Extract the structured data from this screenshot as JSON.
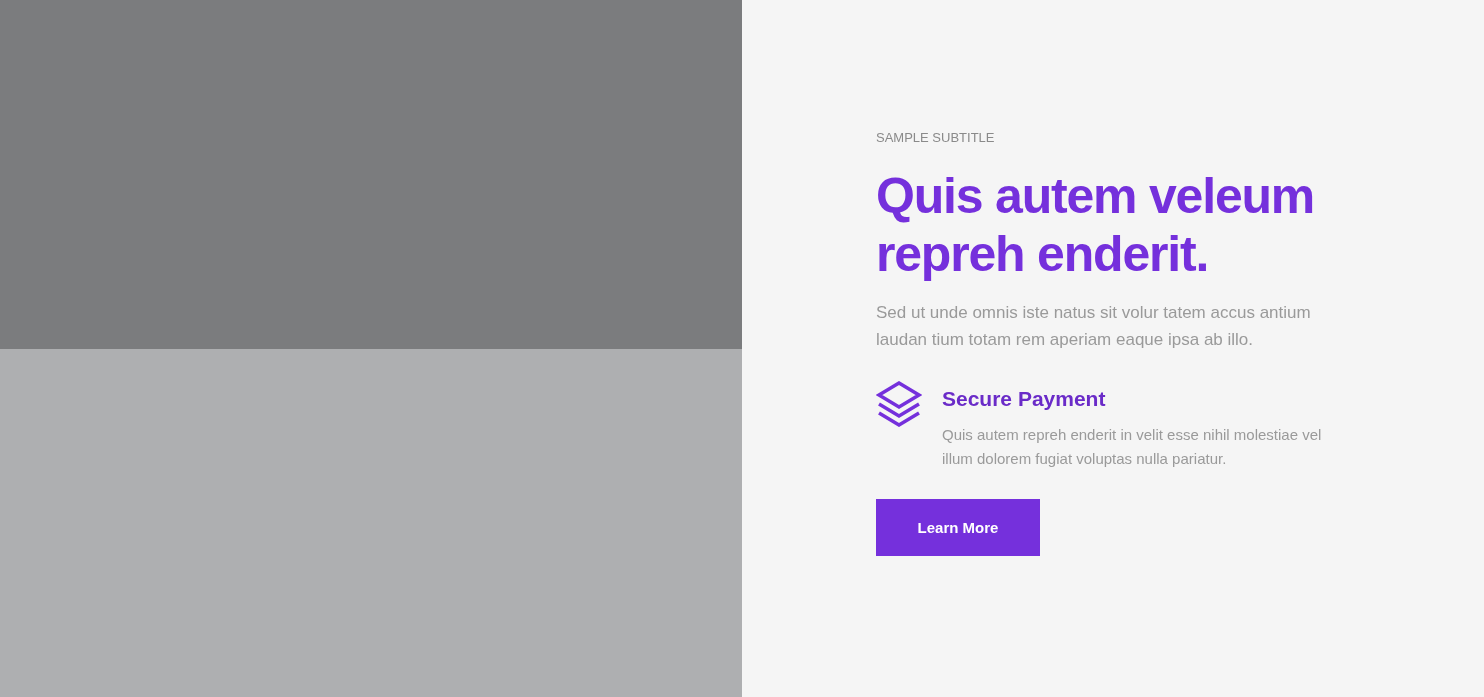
{
  "subtitle": "SAMPLE SUBTITLE",
  "heading": "Quis autem veleum repreh enderit.",
  "intro": "Sed ut unde omnis iste natus sit volur tatem accus antium laudan tium totam rem aperiam eaque ipsa ab illo.",
  "features": [
    {
      "title": "Secure Payment",
      "text": "Quis autem repreh enderit in velit esse nihil molestiae vel illum dolorem fugiat voluptas nulla pariatur."
    }
  ],
  "button": "Learn More"
}
